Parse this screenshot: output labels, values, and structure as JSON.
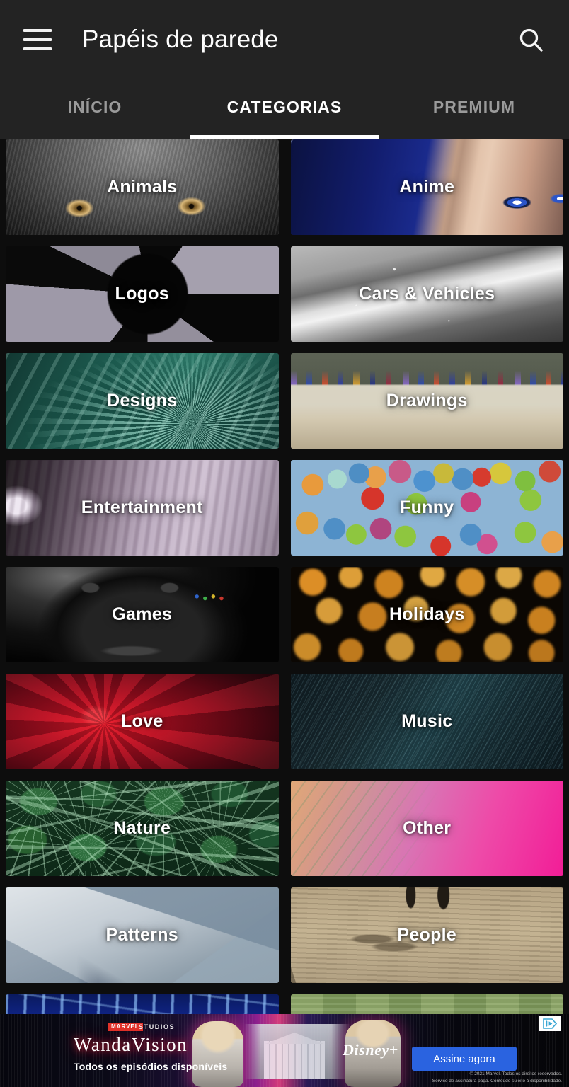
{
  "appbar": {
    "menu_icon": "hamburger-menu-icon",
    "title": "Papéis de parede",
    "search_icon": "search-icon"
  },
  "tabs": {
    "items": [
      {
        "label": "INÍCIO",
        "active": false
      },
      {
        "label": "CATEGORIAS",
        "active": true
      },
      {
        "label": "PREMIUM",
        "active": false
      }
    ],
    "active_index": 1,
    "indicator_color": "#ffffff"
  },
  "categories": [
    {
      "label": "Animals",
      "art": "art-animals"
    },
    {
      "label": "Anime",
      "art": "art-anime"
    },
    {
      "label": "Logos",
      "art": "art-logos"
    },
    {
      "label": "Cars & Vehicles",
      "art": "art-cars"
    },
    {
      "label": "Designs",
      "art": "art-designs"
    },
    {
      "label": "Drawings",
      "art": "art-drawings"
    },
    {
      "label": "Entertainment",
      "art": "art-entertainment"
    },
    {
      "label": "Funny",
      "art": "art-funny"
    },
    {
      "label": "Games",
      "art": "art-games"
    },
    {
      "label": "Holidays",
      "art": "art-holidays"
    },
    {
      "label": "Love",
      "art": "art-love"
    },
    {
      "label": "Music",
      "art": "art-music"
    },
    {
      "label": "Nature",
      "art": "art-nature"
    },
    {
      "label": "Other",
      "art": "art-other"
    },
    {
      "label": "Patterns",
      "art": "art-patterns"
    },
    {
      "label": "People",
      "art": "art-people"
    },
    {
      "label": "",
      "art": "art-quotes"
    },
    {
      "label": "",
      "art": "art-sports"
    }
  ],
  "ad": {
    "brand_marvel": "MARVEL",
    "brand_studios": "STUDIOS",
    "title": "WandaVision",
    "subtitle": "Todos os episódios disponíveis",
    "network": "Disney",
    "network_plus": "+",
    "cta_label": "Assine agora",
    "legal_line1": "© 2021 Marvel. Todos os direitos reservados.",
    "legal_line2": "Serviço de assinatura paga. Conteúdo sujeito à disponibilidade.",
    "adchoices_icon": "adchoices-icon",
    "cta_color": "#2a63e0"
  },
  "theme": {
    "background": "#0d0d0d",
    "appbar_background": "#232323",
    "text_primary": "#ffffff",
    "text_muted": "#9a9a9a"
  }
}
